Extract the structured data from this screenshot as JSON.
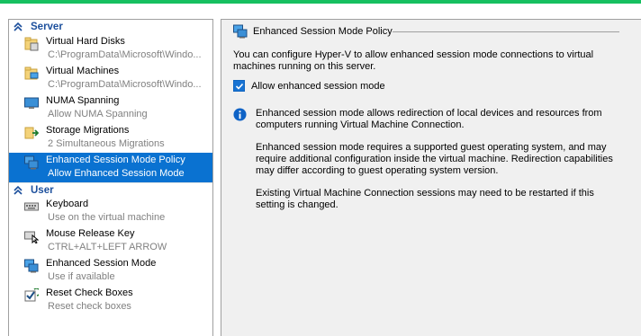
{
  "colors": {
    "top_strip": "#16c060",
    "accent_blue": "#1c4f9c",
    "selection": "#0a72d1",
    "checkbox": "#1873d3",
    "info_icon": "#0f63c6"
  },
  "sidebar": {
    "server_header": "Server",
    "user_header": "User",
    "server_items": [
      {
        "title": "Virtual Hard Disks",
        "sub": "C:\\ProgramData\\Microsoft\\Windo...",
        "icon": "folder-disk-icon"
      },
      {
        "title": "Virtual Machines",
        "sub": "C:\\ProgramData\\Microsoft\\Windo...",
        "icon": "folder-vm-icon"
      },
      {
        "title": "NUMA Spanning",
        "sub": "Allow NUMA Spanning",
        "icon": "monitor-icon"
      },
      {
        "title": "Storage Migrations",
        "sub": "2 Simultaneous Migrations",
        "icon": "storage-migration-icon"
      },
      {
        "title": "Enhanced Session Mode Policy",
        "sub": "Allow Enhanced Session Mode",
        "icon": "enhanced-session-icon",
        "selected": true
      }
    ],
    "user_items": [
      {
        "title": "Keyboard",
        "sub": "Use on the virtual machine",
        "icon": "keyboard-icon"
      },
      {
        "title": "Mouse Release Key",
        "sub": "CTRL+ALT+LEFT ARROW",
        "icon": "mouse-icon"
      },
      {
        "title": "Enhanced Session Mode",
        "sub": "Use if available",
        "icon": "enhanced-session-icon"
      },
      {
        "title": "Reset Check Boxes",
        "sub": "Reset check boxes",
        "icon": "reset-checkbox-icon"
      }
    ]
  },
  "main": {
    "header_title": "Enhanced Session Mode Policy",
    "description": "You can configure Hyper-V to allow enhanced session mode connections to virtual machines running on this server.",
    "checkbox_label": "Allow enhanced session mode",
    "checkbox_checked": true,
    "info_paragraphs": [
      "Enhanced session mode allows redirection of local devices and resources from computers running Virtual Machine Connection.",
      "Enhanced session mode requires a supported guest operating system, and may require additional configuration inside the virtual machine. Redirection capabilities may differ according to guest operating system version.",
      "Existing Virtual Machine Connection sessions may need to be restarted if this setting is changed."
    ]
  }
}
